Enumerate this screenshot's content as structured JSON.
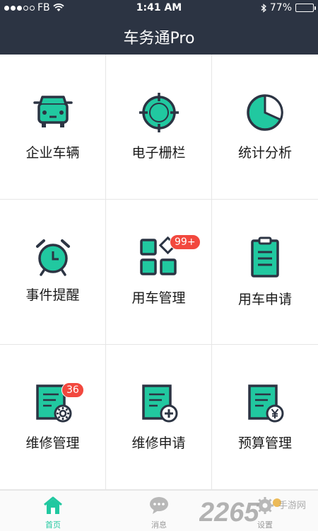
{
  "status_bar": {
    "carrier": "FB",
    "time": "1:41 AM",
    "battery": "77%",
    "battery_level": 0.77,
    "signal_icon": "signal-dots-icon",
    "wifi_icon": "wifi-icon",
    "bluetooth_icon": "bluetooth-icon"
  },
  "header": {
    "title": "车务通Pro"
  },
  "grid": [
    {
      "label": "企业车辆",
      "icon": "car-icon"
    },
    {
      "label": "电子栅栏",
      "icon": "geofence-icon"
    },
    {
      "label": "统计分析",
      "icon": "pie-chart-icon"
    },
    {
      "label": "事件提醒",
      "icon": "alarm-clock-icon"
    },
    {
      "label": "用车管理",
      "icon": "apps-grid-icon",
      "badge": "99+"
    },
    {
      "label": "用车申请",
      "icon": "clipboard-icon"
    },
    {
      "label": "维修管理",
      "icon": "document-gear-icon",
      "badge": "36"
    },
    {
      "label": "维修申请",
      "icon": "document-plus-icon"
    },
    {
      "label": "预算管理",
      "icon": "document-yen-icon"
    }
  ],
  "tabbar": [
    {
      "label": "首页",
      "icon": "home-icon",
      "active": true
    },
    {
      "label": "消息",
      "icon": "chat-bubble-icon",
      "active": false
    },
    {
      "label": "设置",
      "icon": "settings-icon",
      "active": false
    }
  ],
  "watermark": {
    "number": "2265",
    "sub": "手游网",
    "brand_color": "#9a9a9a"
  },
  "colors": {
    "header_bg": "#2c3443",
    "accent": "#21c8a0",
    "icon_outline": "#2c3443",
    "badge_bg": "#f2483e",
    "tab_inactive": "#9a9a9a"
  }
}
